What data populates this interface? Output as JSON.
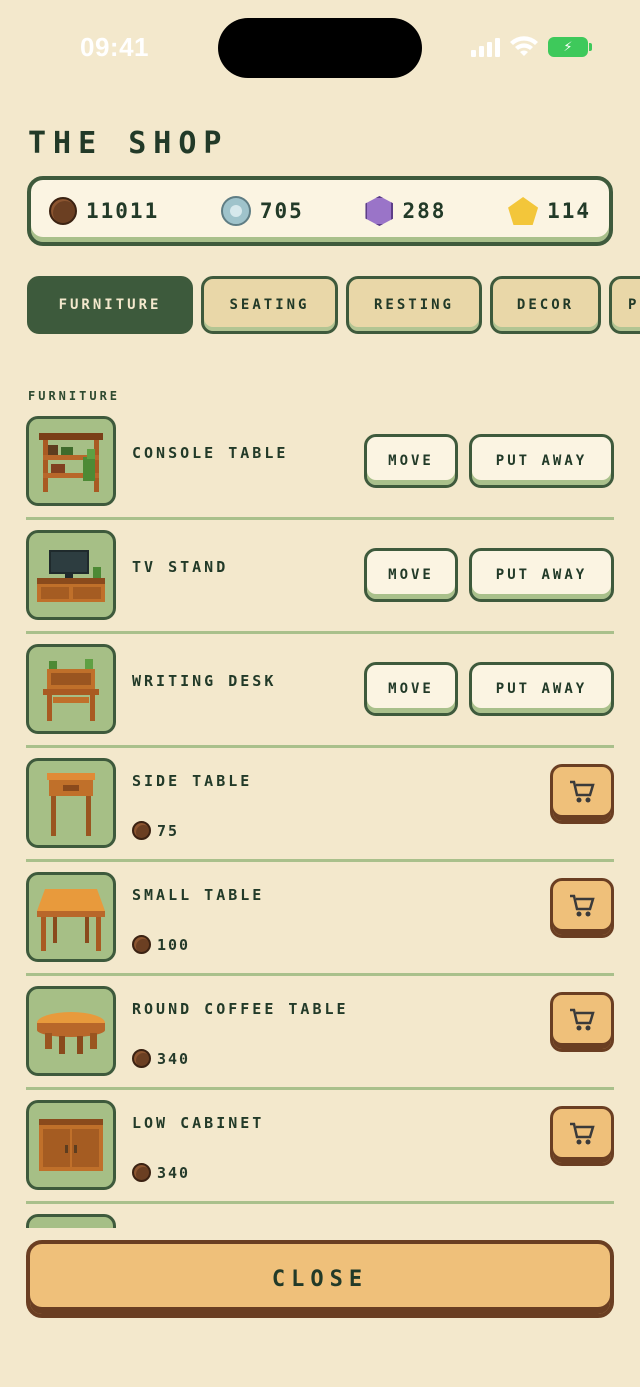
{
  "status_bar": {
    "time": "09:41"
  },
  "shop": {
    "title": "THE SHOP"
  },
  "currencies": [
    {
      "icon": "brown-coin-icon",
      "amount": "11011"
    },
    {
      "icon": "silver-paw-coin-icon",
      "amount": "705"
    },
    {
      "icon": "purple-paw-gem-icon",
      "amount": "288"
    },
    {
      "icon": "gold-paw-gem-icon",
      "amount": "114"
    }
  ],
  "tabs": [
    {
      "label": "FURNITURE",
      "active": true
    },
    {
      "label": "SEATING",
      "active": false
    },
    {
      "label": "RESTING",
      "active": false
    },
    {
      "label": "DECOR",
      "active": false
    },
    {
      "label": "P",
      "active": false
    }
  ],
  "section": {
    "label": "FURNITURE"
  },
  "owned_actions": {
    "move": "MOVE",
    "put_away": "PUT AWAY"
  },
  "items": [
    {
      "name": "CONSOLE TABLE",
      "owned": true,
      "icon": "console-table-icon"
    },
    {
      "name": "TV STAND",
      "owned": true,
      "icon": "tv-stand-icon"
    },
    {
      "name": "WRITING DESK",
      "owned": true,
      "icon": "writing-desk-icon"
    },
    {
      "name": "SIDE TABLE",
      "owned": false,
      "price": "75",
      "icon": "side-table-icon"
    },
    {
      "name": "SMALL TABLE",
      "owned": false,
      "price": "100",
      "icon": "small-table-icon"
    },
    {
      "name": "ROUND COFFEE TABLE",
      "owned": false,
      "price": "340",
      "icon": "round-coffee-table-icon"
    },
    {
      "name": "LOW CABINET",
      "owned": false,
      "price": "340",
      "icon": "low-cabinet-icon"
    }
  ],
  "footer": {
    "close_label": "CLOSE"
  },
  "colors": {
    "background": "#f3e8cc",
    "dark_green": "#3d5a3c",
    "sage": "#a6bf86",
    "cart_orange": "#efc07a",
    "wood": "#c06d24"
  }
}
